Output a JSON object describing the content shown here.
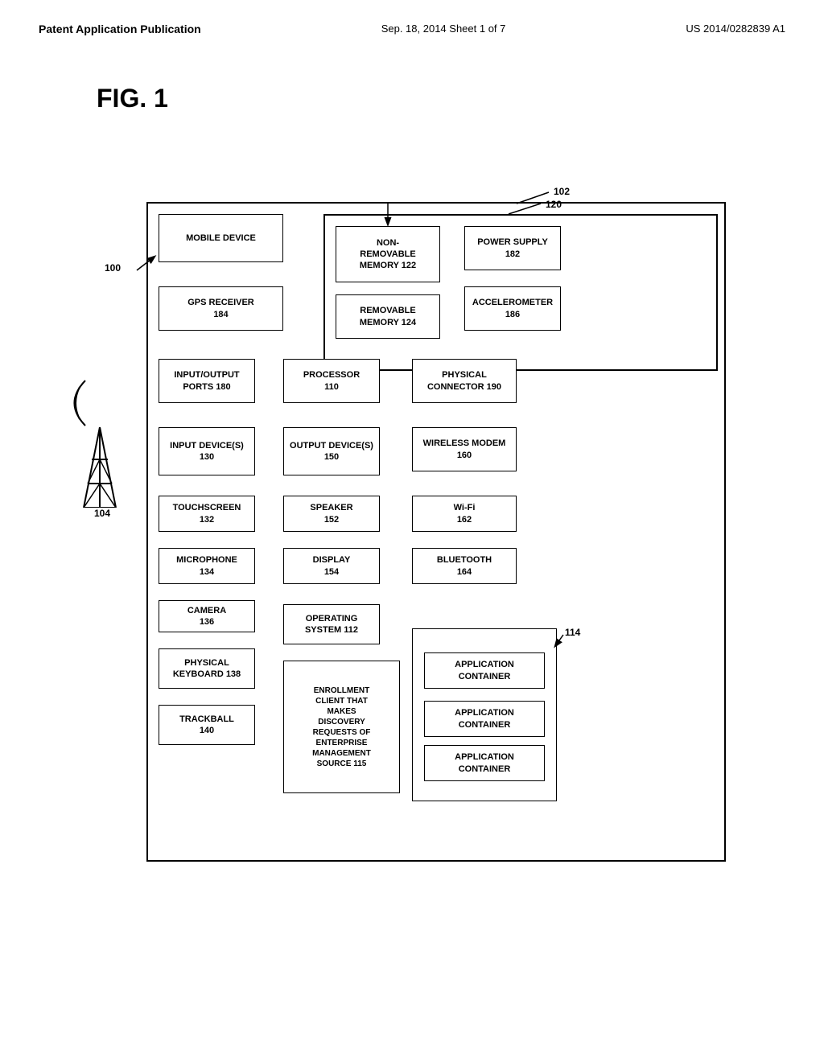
{
  "header": {
    "left": "Patent Application Publication",
    "center": "Sep. 18, 2014   Sheet 1 of 7",
    "right": "US 2014/0282839 A1"
  },
  "figure": {
    "title": "FIG. 1"
  },
  "labels": {
    "ref_100": "100",
    "ref_102": "102",
    "ref_104": "104",
    "ref_114": "114",
    "ref_120": "120"
  },
  "boxes": {
    "mobile_device": "MOBILE  DEVICE",
    "non_removable_memory": "NON-\nREMOVABLE\nMEMORY 122",
    "power_supply": "POWER SUPPLY\n182",
    "gps_receiver": "GPS RECEIVER\n184",
    "removable_memory": "REMOVABLE\nMEMORY 124",
    "accelerometer": "ACCELEROMETER\n186",
    "io_ports": "INPUT/OUTPUT\nPORTS 180",
    "processor": "PROCESSOR\n110",
    "physical_connector": "PHYSICAL\nCONNECTOR 190",
    "input_devices": "INPUT DEVICE(S)\n130",
    "output_devices": "OUTPUT DEVICE(S)\n150",
    "wireless_modem": "WIRELESS MODEM\n160",
    "touchscreen": "TOUCHSCREEN\n132",
    "speaker": "SPEAKER\n152",
    "wifi": "Wi-Fi\n162",
    "microphone": "MICROPHONE\n134",
    "display": "DISPLAY\n154",
    "bluetooth": "BLUETOOTH\n164",
    "camera": "CAMERA\n136",
    "operating_system": "OPERATING\nSYSTEM 112",
    "physical_keyboard": "PHYSICAL\nKEYBOARD 138",
    "app_container_label": "APPLICATION\nCONTAINER",
    "app_container_1": "APPLICATION\nCONTAINER",
    "app_container_2": "APPLICATION\nCONTAINER",
    "app_container_3": "APPLICATION\nCONTAINER",
    "trackball": "TRACKBALL\n140",
    "enrollment": "ENROLLMENT\nCLIENT THAT\nMAKES\nDISCOVERY\nREQUESTS OF\nENTERPRISE\nMANAGEMENT\nSOURCE 115"
  }
}
